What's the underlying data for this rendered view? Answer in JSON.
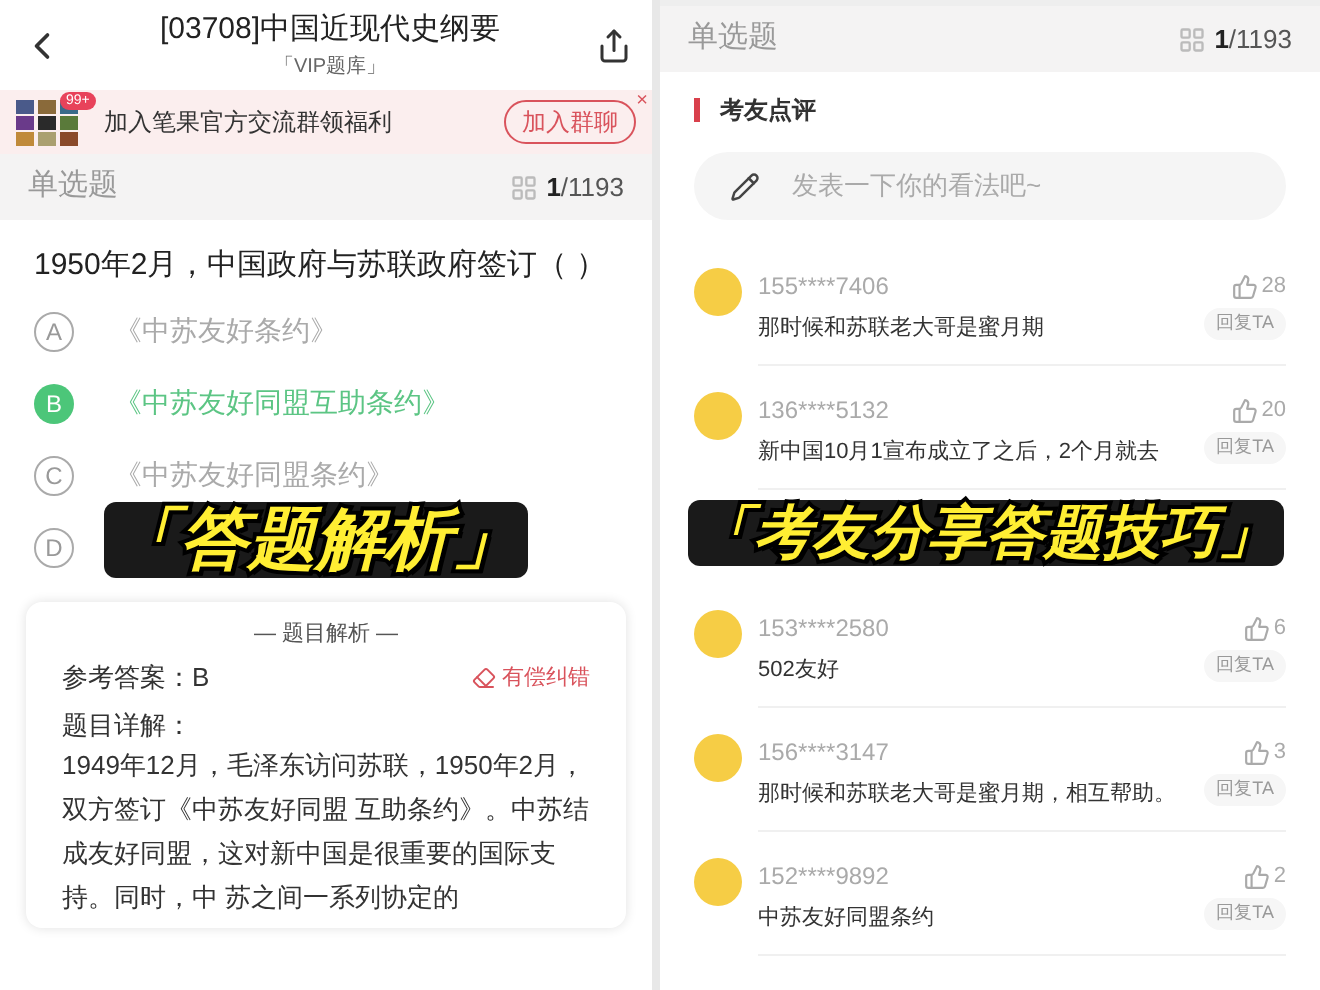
{
  "left": {
    "header": {
      "title": "[03708]中国近现代史纲要",
      "subtitle": "「VIP题库」"
    },
    "banner": {
      "badge": "99+",
      "text": "加入笔果官方交流群领福利",
      "button": "加入群聊",
      "close": "×"
    },
    "question_bar": {
      "type": "单选题",
      "current": "1",
      "total": "/1193"
    },
    "question": "1950年2月，中国政府与苏联政府签订（ ）",
    "options": [
      {
        "letter": "A",
        "text": "《中苏友好条约》",
        "selected": false
      },
      {
        "letter": "B",
        "text": "《中苏友好同盟互助条约》",
        "selected": true
      },
      {
        "letter": "C",
        "text": "《中苏友好同盟条约》",
        "selected": false
      },
      {
        "letter": "D",
        "selected": false
      }
    ],
    "analysis": {
      "title": "— 题目解析 —",
      "answer_label": "参考答案：B",
      "report": "有偿纠错",
      "detail_label": "题目详解：",
      "detail": "1949年12月，毛泽东访问苏联，1950年2月，双方签订《中苏友好同盟 互助条约》。中苏结成友好同盟，这对新中国是很重要的国际支持。同时，中 苏之间一系列协定的"
    },
    "caption": "「答题解析」"
  },
  "right": {
    "question_bar": {
      "type": "单选题",
      "current": "1",
      "total": "/1193"
    },
    "section_title": "考友点评",
    "comment_field": {
      "placeholder": "发表一下你的看法吧~"
    },
    "comments": [
      {
        "user": "155****7406",
        "likes": "28",
        "text": "那时候和苏联老大哥是蜜月期",
        "reply": "回复TA"
      },
      {
        "user": "136****5132",
        "likes": "20",
        "text": "新中国10月1宣布成立了之后，2个月就去",
        "reply": "回复TA"
      },
      {
        "user": "153****2580",
        "likes": "6",
        "text": "502友好",
        "reply": "回复TA"
      },
      {
        "user": "156****3147",
        "likes": "3",
        "text": "那时候和苏联老大哥是蜜月期，相互帮助。",
        "reply": "回复TA"
      },
      {
        "user": "152****9892",
        "likes": "2",
        "text": "中苏友好同盟条约",
        "reply": "回复TA"
      }
    ],
    "caption": "「考友分享答题技巧」"
  }
}
